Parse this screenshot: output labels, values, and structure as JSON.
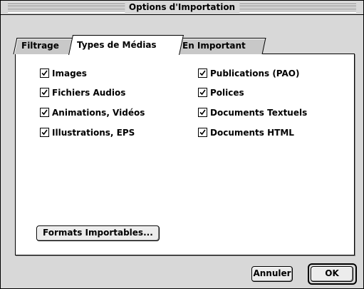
{
  "window": {
    "title": "Options d'Importation"
  },
  "tabs": [
    {
      "label": "Filtrage"
    },
    {
      "label": "Types de Médias"
    },
    {
      "label": "En Important"
    }
  ],
  "media_types": {
    "left": [
      {
        "label": "Images",
        "checked": true
      },
      {
        "label": "Fichiers Audios",
        "checked": true
      },
      {
        "label": "Animations, Vidéos",
        "checked": true
      },
      {
        "label": "Illustrations, EPS",
        "checked": true
      }
    ],
    "right": [
      {
        "label": "Publications (PAO)",
        "checked": true
      },
      {
        "label": "Polices",
        "checked": true
      },
      {
        "label": "Documents Textuels",
        "checked": true
      },
      {
        "label": "Documents HTML",
        "checked": true
      }
    ]
  },
  "buttons": {
    "formats": "Formats Importables...",
    "cancel": "Annuler",
    "ok": "OK"
  }
}
